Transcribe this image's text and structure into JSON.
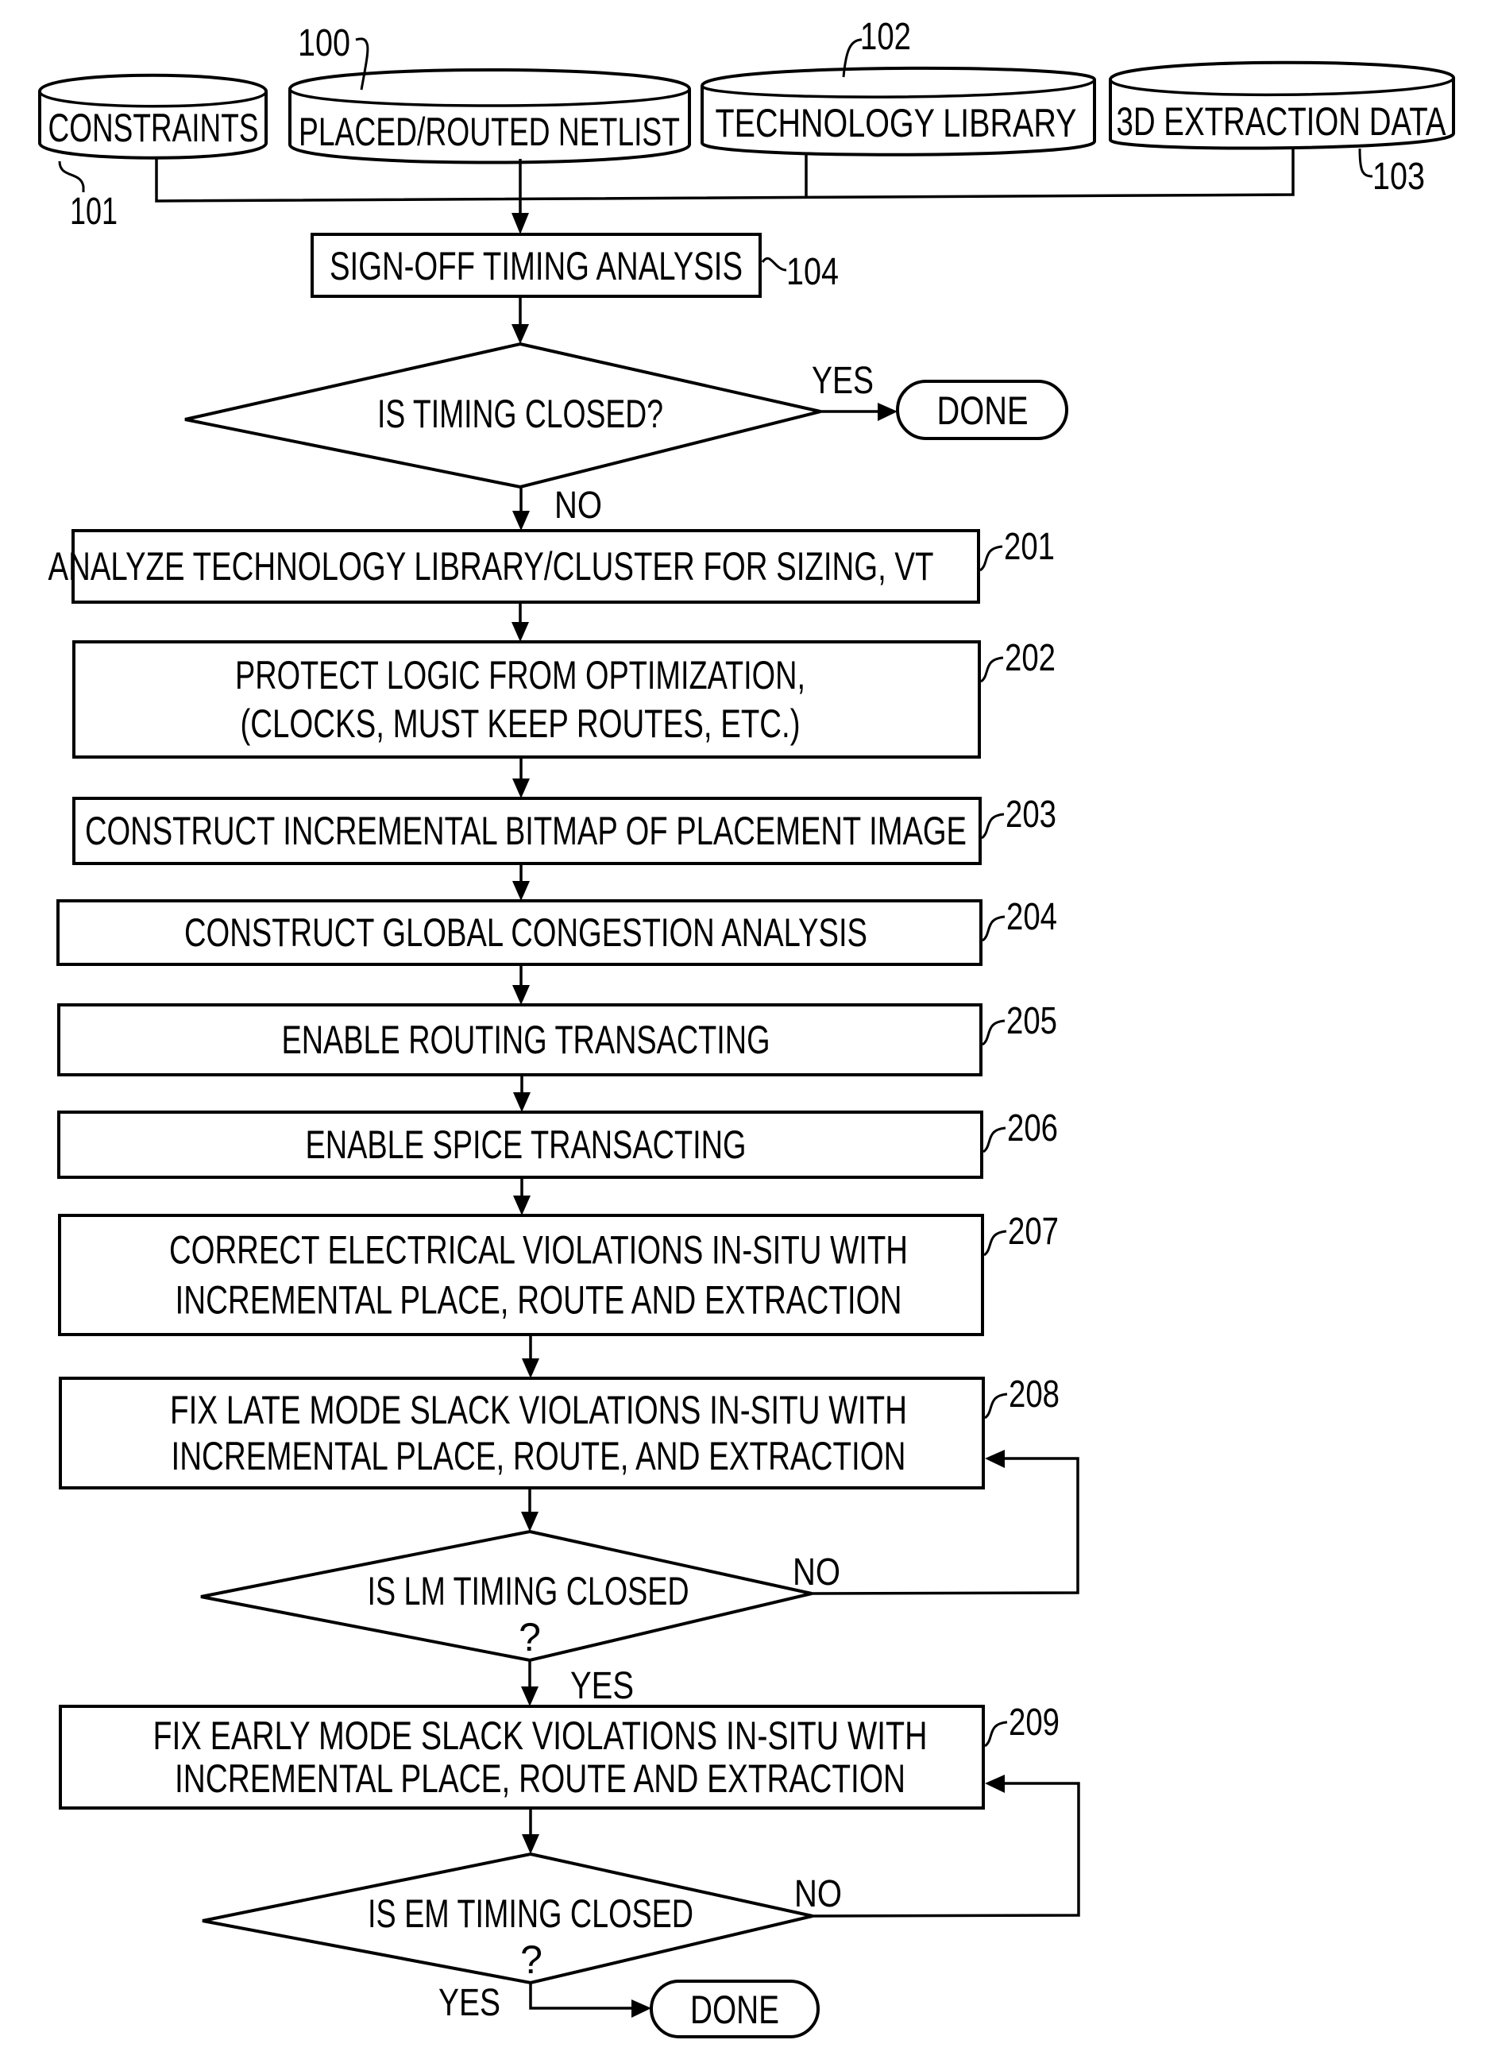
{
  "diagram": {
    "type": "flowchart",
    "inputs": [
      {
        "id": "constraints",
        "label": "CONSTRAINTS",
        "ref": "101"
      },
      {
        "id": "netlist",
        "label": "PLACED/ROUTED NETLIST",
        "ref": "100"
      },
      {
        "id": "techlib",
        "label": "TECHNOLOGY LIBRARY",
        "ref": "102"
      },
      {
        "id": "extraction",
        "label": "3D EXTRACTION DATA",
        "ref": "103"
      }
    ],
    "signoff": {
      "label": "SIGN-OFF TIMING ANALYSIS",
      "ref": "104"
    },
    "decision1": {
      "label": "IS TIMING CLOSED?",
      "yes": "YES",
      "no": "NO"
    },
    "done1": {
      "label": "DONE"
    },
    "steps": [
      {
        "ref": "201",
        "lines": [
          "ANALYZE TECHNOLOGY LIBRARY/CLUSTER FOR SIZING, VT"
        ]
      },
      {
        "ref": "202",
        "lines": [
          "PROTECT LOGIC FROM OPTIMIZATION,",
          "(CLOCKS, MUST KEEP ROUTES, ETC.)"
        ]
      },
      {
        "ref": "203",
        "lines": [
          "CONSTRUCT INCREMENTAL BITMAP OF PLACEMENT IMAGE"
        ]
      },
      {
        "ref": "204",
        "lines": [
          "CONSTRUCT GLOBAL CONGESTION ANALYSIS"
        ]
      },
      {
        "ref": "205",
        "lines": [
          "ENABLE ROUTING TRANSACTING"
        ]
      },
      {
        "ref": "206",
        "lines": [
          "ENABLE SPICE TRANSACTING"
        ]
      },
      {
        "ref": "207",
        "lines": [
          "CORRECT  ELECTRICAL VIOLATIONS IN-SITU WITH",
          "INCREMENTAL PLACE,  ROUTE AND EXTRACTION"
        ]
      },
      {
        "ref": "208",
        "lines": [
          "FIX LATE MODE SLACK VIOLATIONS IN-SITU WITH",
          "INCREMENTAL PLACE,  ROUTE, AND  EXTRACTION"
        ]
      },
      {
        "ref": "209",
        "lines": [
          "FIX EARLY MODE SLACK VIOLATIONS IN-SITU WITH",
          "INCREMENTAL PLACE,  ROUTE AND EXTRACTION"
        ]
      }
    ],
    "decision_lm": {
      "lines": [
        "IS LM TIMING CLOSED",
        "?"
      ],
      "yes": "YES",
      "no": "NO"
    },
    "decision_em": {
      "lines": [
        "IS EM TIMING CLOSED",
        "?"
      ],
      "yes": "YES",
      "no": "NO"
    },
    "done2": {
      "label": "DONE"
    }
  }
}
